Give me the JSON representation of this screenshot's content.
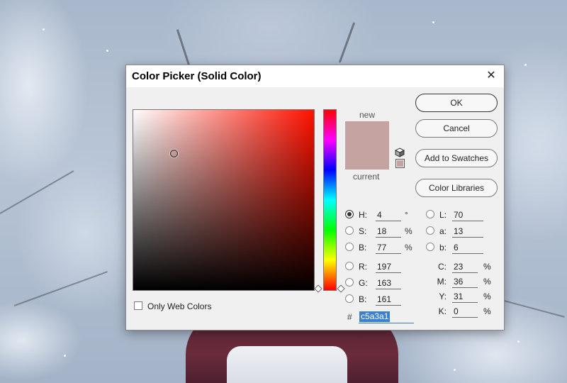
{
  "dialog": {
    "title": "Color Picker (Solid Color)",
    "close_glyph": "✕"
  },
  "swatches": {
    "new_label": "new",
    "current_label": "current",
    "new_color": "#c5a3a1",
    "current_color": "#c5a3a1"
  },
  "field": {
    "base_hue_color": "#ff1100"
  },
  "buttons": {
    "ok": "OK",
    "cancel": "Cancel",
    "add_to_swatches": "Add to Swatches",
    "color_libraries": "Color Libraries"
  },
  "hsb": {
    "h_label": "H:",
    "h_value": "4",
    "h_unit": "°",
    "s_label": "S:",
    "s_value": "18",
    "s_unit": "%",
    "b_label": "B:",
    "b_value": "77",
    "b_unit": "%"
  },
  "rgb": {
    "r_label": "R:",
    "r_value": "197",
    "g_label": "G:",
    "g_value": "163",
    "b_label": "B:",
    "b_value": "161"
  },
  "lab": {
    "l_label": "L:",
    "l_value": "70",
    "a_label": "a:",
    "a_value": "13",
    "b_label": "b:",
    "b_value": "6"
  },
  "cmyk": {
    "c_label": "C:",
    "c_value": "23",
    "m_label": "M:",
    "m_value": "36",
    "y_label": "Y:",
    "y_value": "31",
    "k_label": "K:",
    "k_value": "0",
    "unit": "%"
  },
  "hex": {
    "hash": "#",
    "value": "c5a3a1"
  },
  "web_colors": {
    "label": "Only Web Colors",
    "checked": false
  },
  "icons": {
    "cube": "gamut-cube-icon",
    "close": "close-icon"
  }
}
